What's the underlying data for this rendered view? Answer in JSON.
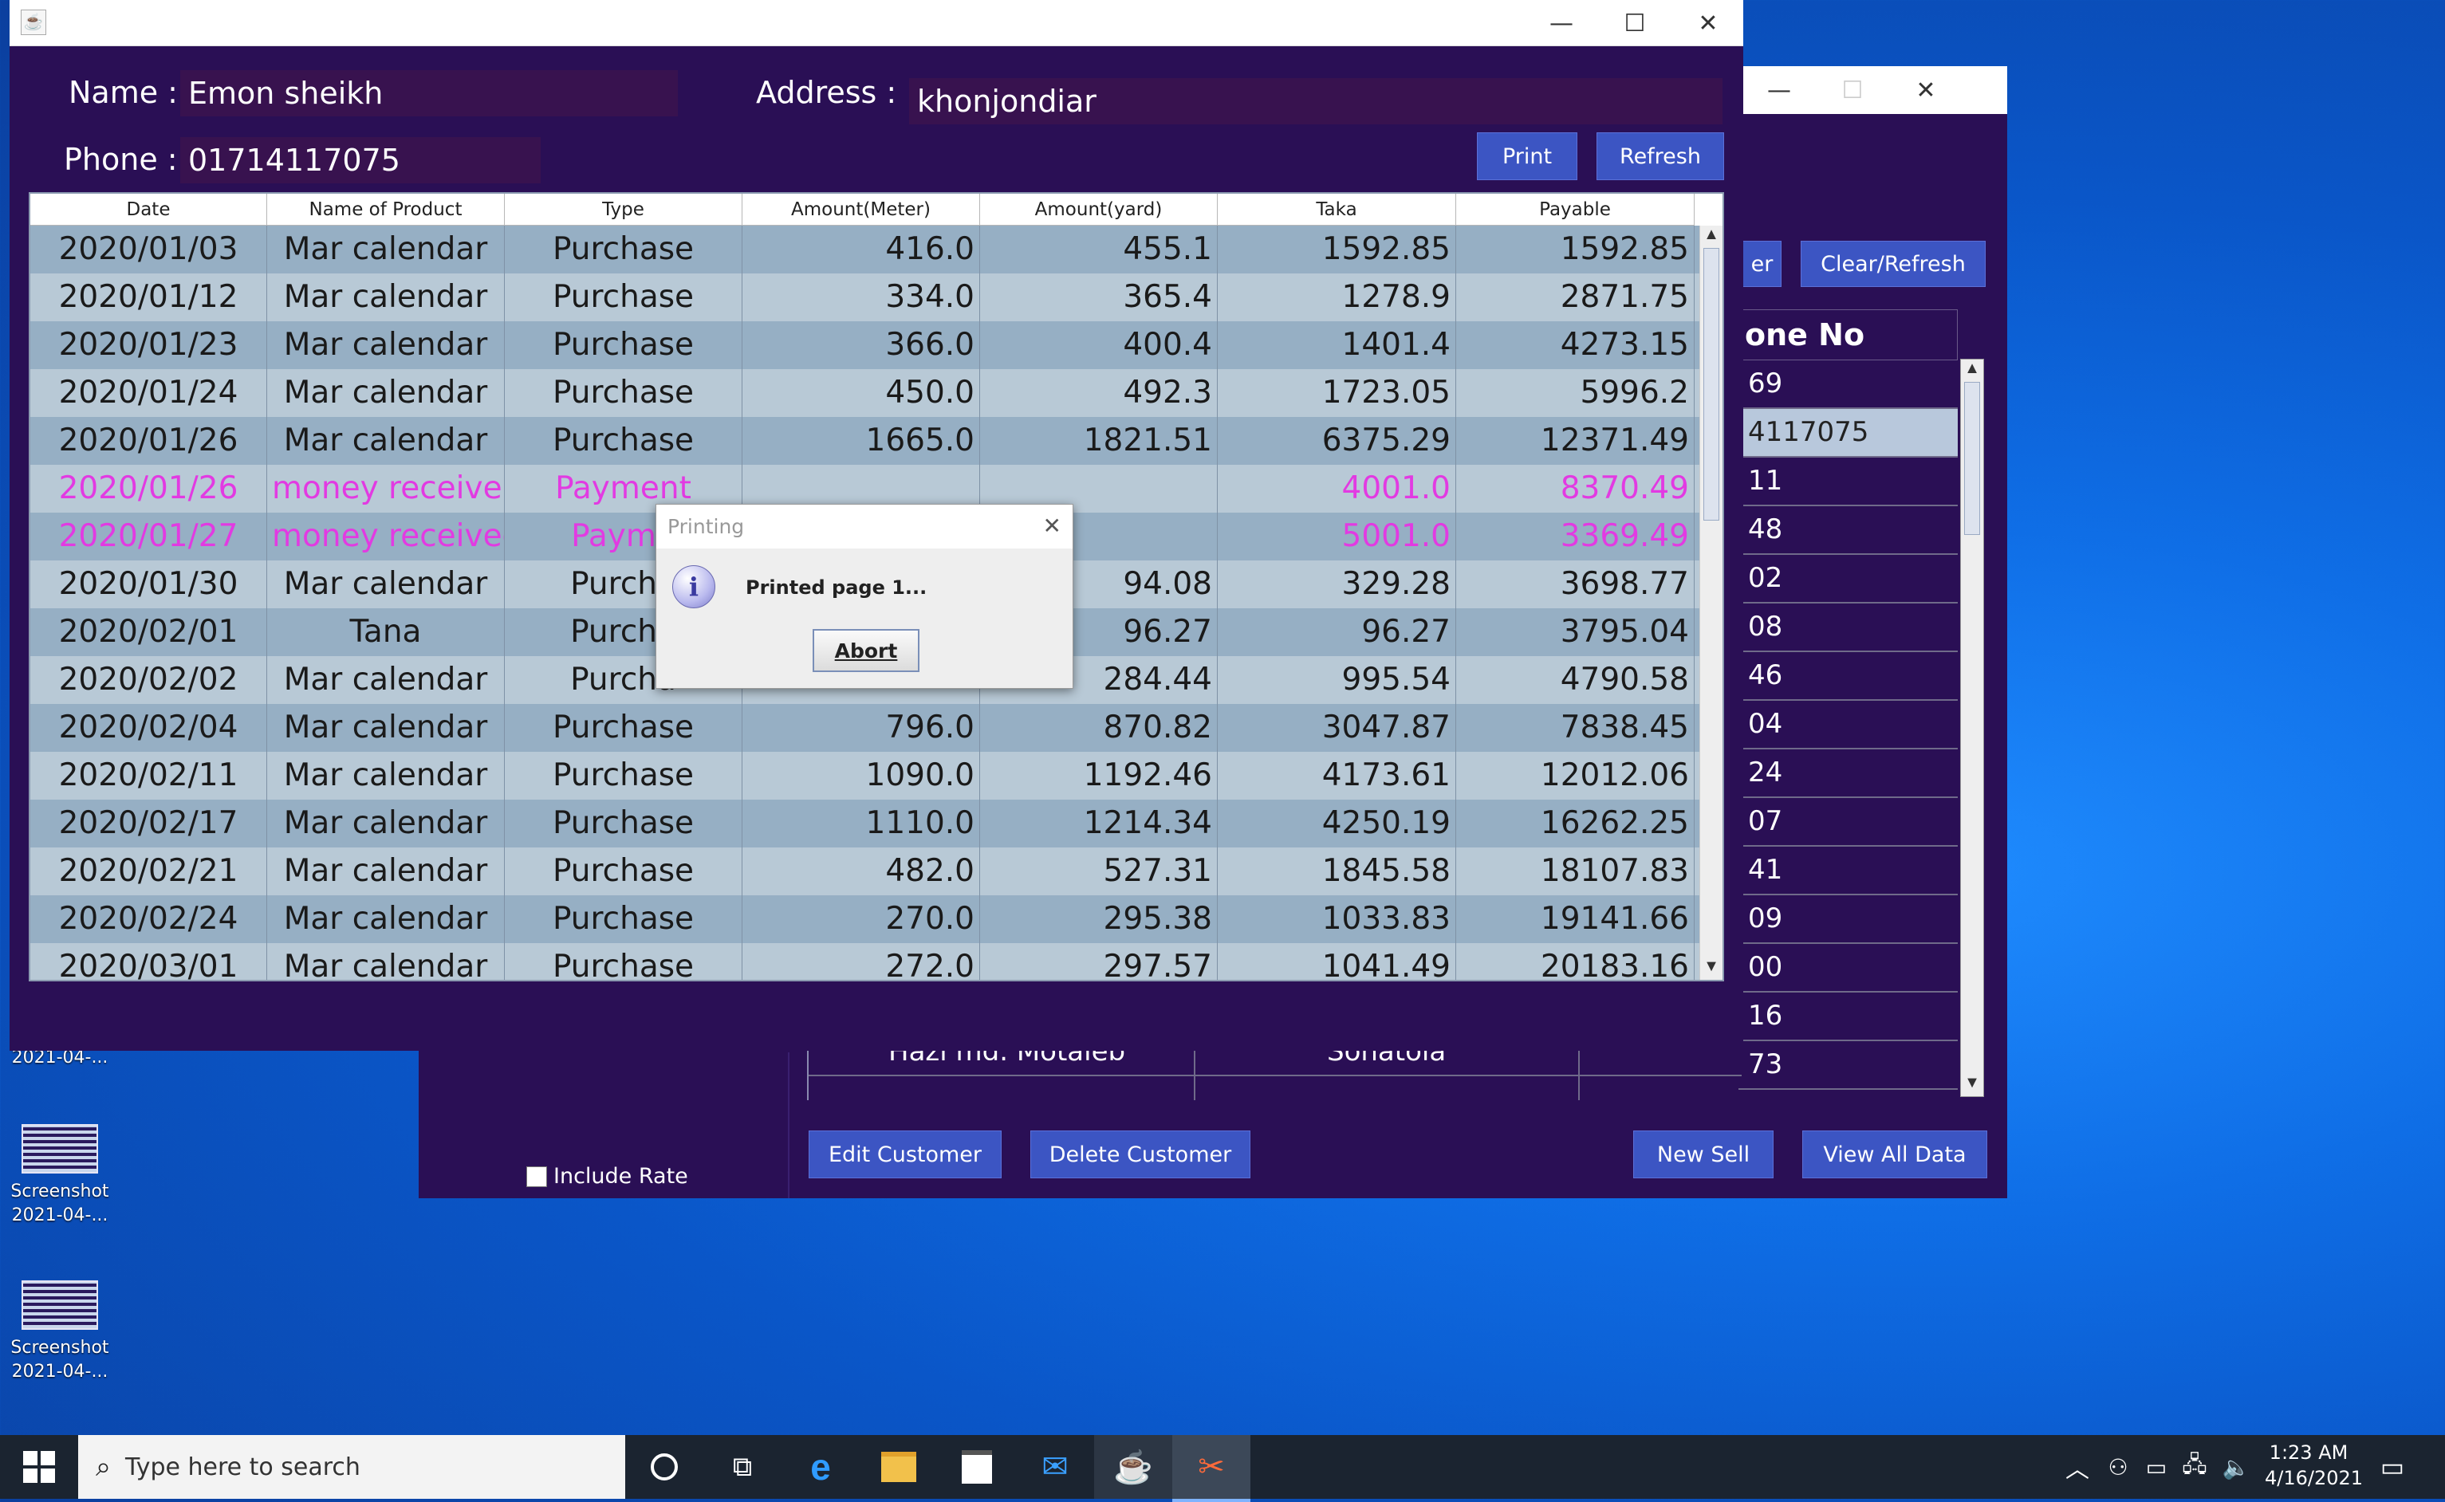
{
  "desktop": {
    "icons": [
      {
        "name": "Screenshot",
        "date": "2021-04-..."
      },
      {
        "name": "Screenshot",
        "date": "2021-04-..."
      }
    ],
    "partial_date": "2021-04-..."
  },
  "back_window": {
    "partial_button_label": "er",
    "clear_refresh_label": "Clear/Refresh",
    "phone_header": "one No",
    "phone_values": [
      "69",
      "4117075",
      "11",
      "48",
      "02",
      "08",
      "46",
      "04",
      "24",
      "07",
      "41",
      "09",
      "00",
      "16",
      "73"
    ],
    "partial_row": {
      "name": "Hazi md. Motaleb",
      "address": "Sonatola"
    },
    "include_rate_label": "Include Rate",
    "edit_customer_label": "Edit Customer",
    "delete_customer_label": "Delete Customer",
    "new_sell_label": "New Sell",
    "view_all_label": "View All Data"
  },
  "front_window": {
    "name_label": "Name :",
    "name_value": "Emon sheikh",
    "address_label": "Address :",
    "address_value": "khonjondiar",
    "phone_label": "Phone :",
    "phone_value": "01714117075",
    "print_label": "Print",
    "refresh_label": "Refresh",
    "table": {
      "headers": [
        "Date",
        "Name of Product",
        "Type",
        "Amount(Meter)",
        "Amount(yard)",
        "Taka",
        "Payable"
      ],
      "rows": [
        [
          "2020/01/03",
          "Mar calendar",
          "Purchase",
          "416.0",
          "455.1",
          "1592.85",
          "1592.85"
        ],
        [
          "2020/01/12",
          "Mar calendar",
          "Purchase",
          "334.0",
          "365.4",
          "1278.9",
          "2871.75"
        ],
        [
          "2020/01/23",
          "Mar calendar",
          "Purchase",
          "366.0",
          "400.4",
          "1401.4",
          "4273.15"
        ],
        [
          "2020/01/24",
          "Mar calendar",
          "Purchase",
          "450.0",
          "492.3",
          "1723.05",
          "5996.2"
        ],
        [
          "2020/01/26",
          "Mar calendar",
          "Purchase",
          "1665.0",
          "1821.51",
          "6375.29",
          "12371.49"
        ],
        [
          "2020/01/26",
          "money receive",
          "Payment",
          "",
          "",
          "4001.0",
          "8370.49"
        ],
        [
          "2020/01/27",
          "money received",
          "Payme",
          "",
          "",
          "5001.0",
          "3369.49"
        ],
        [
          "2020/01/30",
          "Mar calendar",
          "Purcha",
          "",
          "94.08",
          "329.28",
          "3698.77"
        ],
        [
          "2020/02/01",
          "Tana",
          "Purcha",
          "",
          "96.27",
          "96.27",
          "3795.04"
        ],
        [
          "2020/02/02",
          "Mar calendar",
          "Purcha",
          "",
          "284.44",
          "995.54",
          "4790.58"
        ],
        [
          "2020/02/04",
          "Mar calendar",
          "Purchase",
          "796.0",
          "870.82",
          "3047.87",
          "7838.45"
        ],
        [
          "2020/02/11",
          "Mar calendar",
          "Purchase",
          "1090.0",
          "1192.46",
          "4173.61",
          "12012.06"
        ],
        [
          "2020/02/17",
          "Mar calendar",
          "Purchase",
          "1110.0",
          "1214.34",
          "4250.19",
          "16262.25"
        ],
        [
          "2020/02/21",
          "Mar calendar",
          "Purchase",
          "482.0",
          "527.31",
          "1845.58",
          "18107.83"
        ],
        [
          "2020/02/24",
          "Mar calendar",
          "Purchase",
          "270.0",
          "295.38",
          "1033.83",
          "19141.66"
        ],
        [
          "2020/03/01",
          "Mar calendar",
          "Purchase",
          "272.0",
          "297.57",
          "1041.49",
          "20183.16"
        ]
      ],
      "payment_color": "#e23ae2"
    }
  },
  "dialog": {
    "title": "Printing",
    "message": "Printed page 1...",
    "abort_label": "Abort"
  },
  "taskbar": {
    "search_placeholder": "Type here to search",
    "time": "1:23 AM",
    "date": "4/16/2021"
  },
  "colors": {
    "window_bg": "#2a0f55",
    "button_blue": "#3c55c3",
    "row_odd": "#96afc4",
    "row_even": "#b8c9d6"
  }
}
